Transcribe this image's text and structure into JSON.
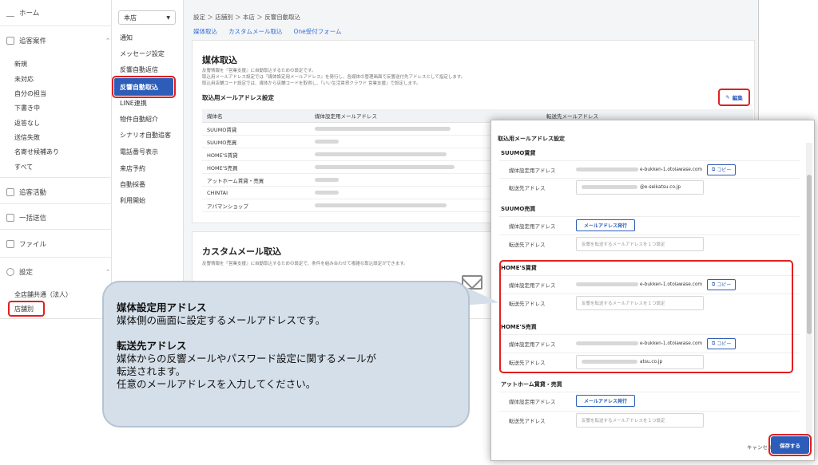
{
  "sidebar": {
    "home": "ホーム",
    "tracking_section": "追客案件",
    "tracking_items": [
      "新規",
      "未対応",
      "自分の担当",
      "下書き中",
      "返答なし",
      "送信失敗",
      "名寄せ候補あり",
      "すべて"
    ],
    "activity": "追客活動",
    "bulk_send": "一括送信",
    "files": "ファイル",
    "settings": "設定",
    "settings_items": [
      "全店舗共通（法人）",
      "店舗別"
    ]
  },
  "subnav": {
    "store": "本店",
    "items": [
      "通知",
      "メッセージ設定",
      "反響自動返信",
      "反響自動取込",
      "LINE連携",
      "物件自動紹介",
      "シナリオ自動追客",
      "電話番号表示",
      "来店予約",
      "自動採番",
      "利用開始"
    ]
  },
  "main": {
    "breadcrumb": "設定 ＞ 店舗別 ＞ 本店 ＞ 反響自動取込",
    "tabs": [
      "媒体取込",
      "カスタムメール取込",
      "One受付フォーム"
    ],
    "panel1": {
      "title": "媒体取込",
      "desc1": "反響情報を『営業支援』に自動取込するための設定です。",
      "desc2": "取込用メールアドレス設定では『媒体設定用メールアドレス』を発行し、各媒体の管理画面で反響送付先アドレスとして指定します。",
      "desc3": "取込用店舗コード設定では、媒体から店舗コードを取得し、『いい生活賃貸クラウド 営業支援』で設定します。",
      "subtitle": "取込用メールアドレス設定",
      "edit_label": "編集",
      "columns": [
        "媒体名",
        "媒体設定用メールアドレス",
        "転送先メールアドレス"
      ],
      "rows": [
        "SUUMO賃貸",
        "SUUMO売買",
        "HOME'S賃貸",
        "HOME'S売買",
        "アットホーム賃貸・売買",
        "CHINTAI",
        "アパマンショップ"
      ]
    },
    "panel2": {
      "title": "カスタムメール取込",
      "desc": "反響情報を『営業支援』に自動取込するための設定で、条件を組み合わせて複雑な取込設定ができます。"
    }
  },
  "modal": {
    "title": "取込用メールアドレス設定",
    "label_media": "媒体設定用アドレス",
    "label_forward": "転送先アドレス",
    "copy_label": "コピー",
    "issue_label": "メールアドレス発行",
    "placeholder": "反響を転送するメールアドレスを１つ設定",
    "sections": [
      {
        "name": "SUUMO賃貸",
        "media_domain": "e-bukken-1.otoiawase.com",
        "forward_domain": "@e-seikatsu.co.jp"
      },
      {
        "name": "SUUMO売買"
      },
      {
        "name": "HOME'S賃貸",
        "media_domain": "e-bukken-1.otoiawase.com"
      },
      {
        "name": "HOME'S売買",
        "media_domain": "e-bukken-1.otoiawase.com",
        "forward_domain": "atsu.co.jp"
      },
      {
        "name": "アットホーム賃貸・売買"
      }
    ],
    "cancel": "キャンセル",
    "save": "保存する"
  },
  "callout": {
    "h1": "媒体設定用アドレス",
    "t1": "媒体側の画面に設定するメールアドレスです。",
    "h2": "転送先アドレス",
    "t2a": "媒体からの反響メールやパスワード設定に関するメールが",
    "t2b": "転送されます。",
    "t2c": "任意のメールアドレスを入力してください。"
  }
}
